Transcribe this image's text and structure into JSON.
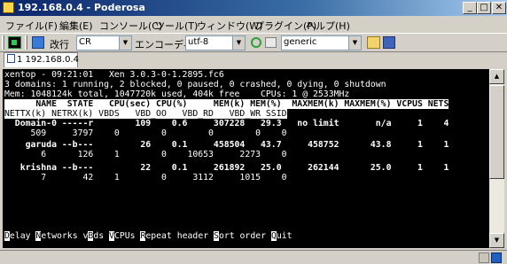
{
  "window": {
    "title": "192.168.0.4 - Poderosa"
  },
  "menu": [
    "ファイル(F)",
    "編集(E)",
    "コンソール(C)",
    "ツール(T)",
    "ウィンドウ(W)",
    "プラグイン(P)",
    "ヘルプ(H)"
  ],
  "toolbar": {
    "newline_label": "改行",
    "newline_value": "CR",
    "encoding_label": "エンコーディング",
    "encoding_value": "utf-8",
    "terminal_type_value": "generic"
  },
  "tab": {
    "label": "1 192.168.0.4"
  },
  "terminal": {
    "header_line": "xentop - 09:21:01   Xen 3.0.3-0-1.2895.fc6",
    "domains_line": "3 domains: 1 running, 2 blocked, 0 paused, 0 crashed, 0 dying, 0 shutdown",
    "mem_line": "Mem: 1048124k total, 1047720k used, 404k free    CPUs: 1 @ 2533MHz",
    "col_header_1": "      NAME  STATE   CPU(sec) CPU(%)     MEM(k) MEM(%)  MAXMEM(k) MAXMEM(%) VCPUS NETS",
    "col_header_2": "NETTX(k) NETRX(k) VBDS   VBD_OO   VBD_RD   VBD_WR SSID",
    "rows": [
      {
        "name": "Domain-0",
        "line1": "  Domain-0 -----r        109    0.6     307228   29.3   no limit       n/a     1    4",
        "line2": "     509     3797    0        0        0        0    0"
      },
      {
        "name": "garuda",
        "line1": "    garuda --b---         26    0.1     458504   43.7     458752      43.8     1    1",
        "line2": "       6      126    1        0    10653     2273    0"
      },
      {
        "name": "krishna",
        "line1": "   krishna --b---         22    0.1     261892   25.0     262144      25.0     1    1",
        "line2": "       7       42    1        0     3112     1015    0"
      }
    ],
    "shortcuts": [
      {
        "key": "D",
        "rest": "elay"
      },
      {
        "key": "N",
        "rest": "etworks"
      },
      {
        "key": "",
        "pre": "v",
        "key2": "B",
        "rest": "ds"
      },
      {
        "key": "V",
        "rest": "CPUs"
      },
      {
        "key": "R",
        "rest": "epeat header"
      },
      {
        "key": "S",
        "rest": "ort order"
      },
      {
        "key": "Q",
        "rest": "uit"
      }
    ]
  },
  "colors": {
    "titlebar": "#0a246a",
    "terminal_bg": "#000000",
    "terminal_fg": "#ffffff",
    "chrome": "#d4d0c8"
  }
}
